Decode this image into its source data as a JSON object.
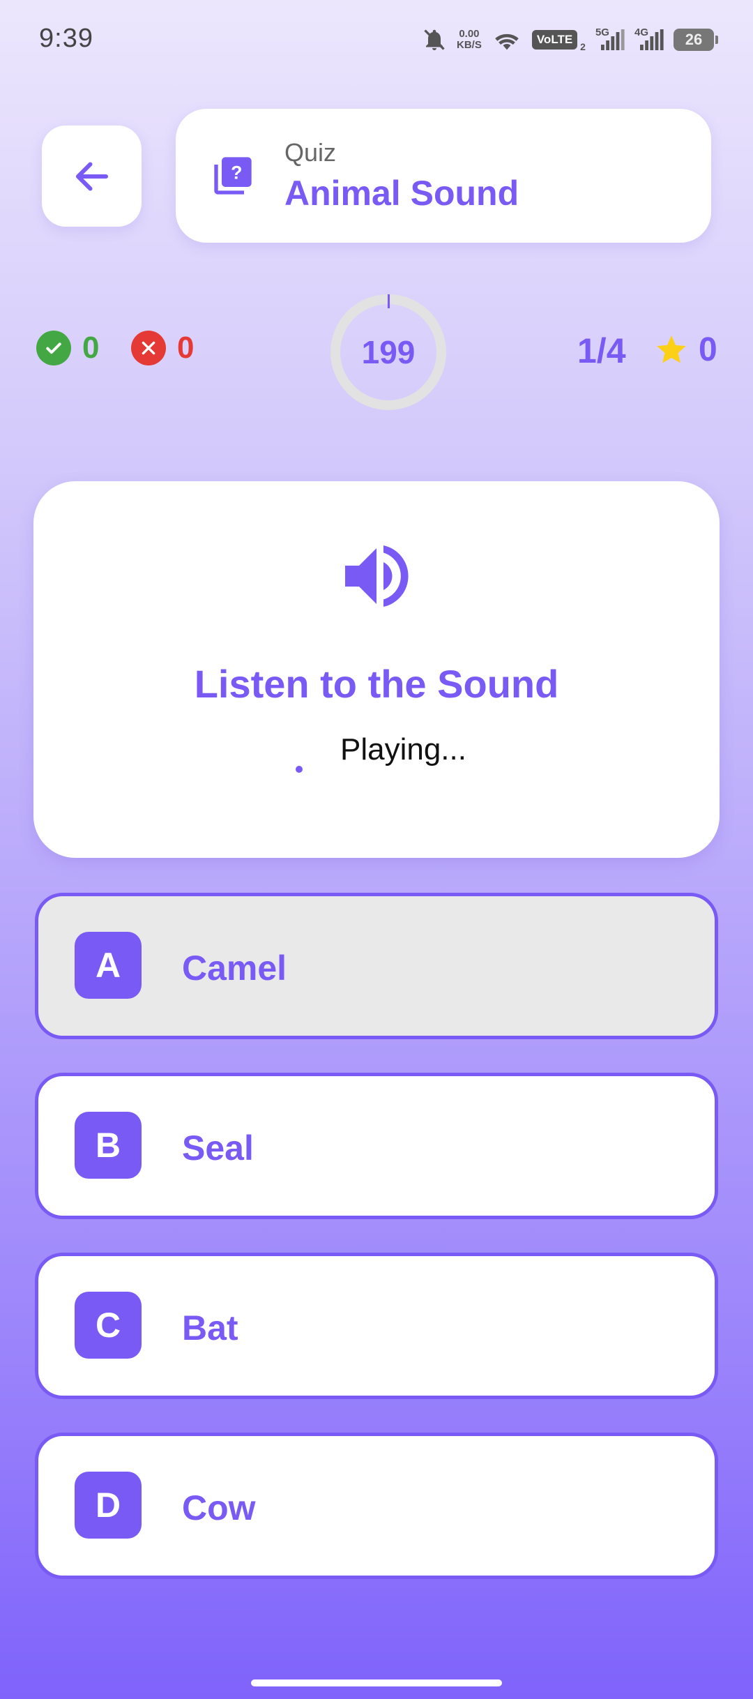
{
  "status_bar": {
    "time": "9:39",
    "speed_value": "0.00",
    "speed_unit": "KB/S",
    "volte": "VoLTE",
    "volte_sub": "2",
    "net1": "5G",
    "net2": "4G",
    "battery": "26"
  },
  "header": {
    "label": "Quiz",
    "title": "Animal Sound"
  },
  "stats": {
    "correct": "0",
    "wrong": "0",
    "timer": "199",
    "progress": "1/4",
    "stars": "0"
  },
  "question": {
    "title": "Listen to the Sound",
    "status": "Playing..."
  },
  "options": [
    {
      "letter": "A",
      "text": "Camel",
      "selected": true
    },
    {
      "letter": "B",
      "text": "Seal",
      "selected": false
    },
    {
      "letter": "C",
      "text": "Bat",
      "selected": false
    },
    {
      "letter": "D",
      "text": "Cow",
      "selected": false
    }
  ],
  "colors": {
    "accent": "#7a5af5",
    "correct": "#43a843",
    "wrong": "#e53935",
    "star": "#fdd018"
  }
}
